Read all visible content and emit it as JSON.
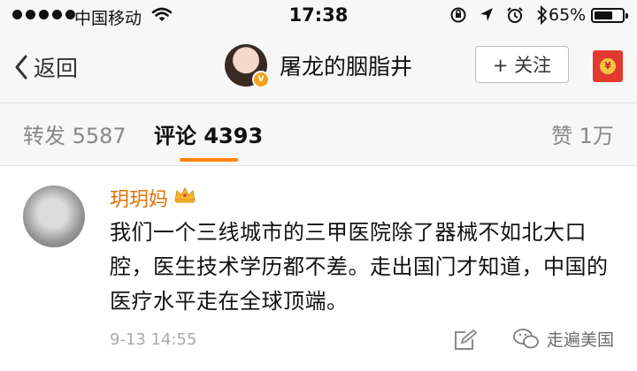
{
  "status_bar": {
    "carrier": "中国移动",
    "time": "17:38",
    "battery_percent": "65%",
    "battery_level": 0.65
  },
  "nav": {
    "back_label": "返回",
    "title": "屠龙的胭脂井",
    "follow_label": "+ 关注"
  },
  "tabs": {
    "repost": "转发 5587",
    "comments": "评论 4393",
    "likes": "赞 1万"
  },
  "comment": {
    "username": "玥玥妈",
    "text": "我们一个三线城市的三甲医院除了器械不如北大口腔，医生技术学历都不差。走出国门才知道，中国的医疗水平走在全球顶端。",
    "timestamp": "9-13 14:55"
  },
  "watermark": {
    "label": "走遍美国"
  },
  "colors": {
    "accent_orange": "#ff8200",
    "username_orange": "#e0720a",
    "red_packet": "#e23a2e"
  }
}
